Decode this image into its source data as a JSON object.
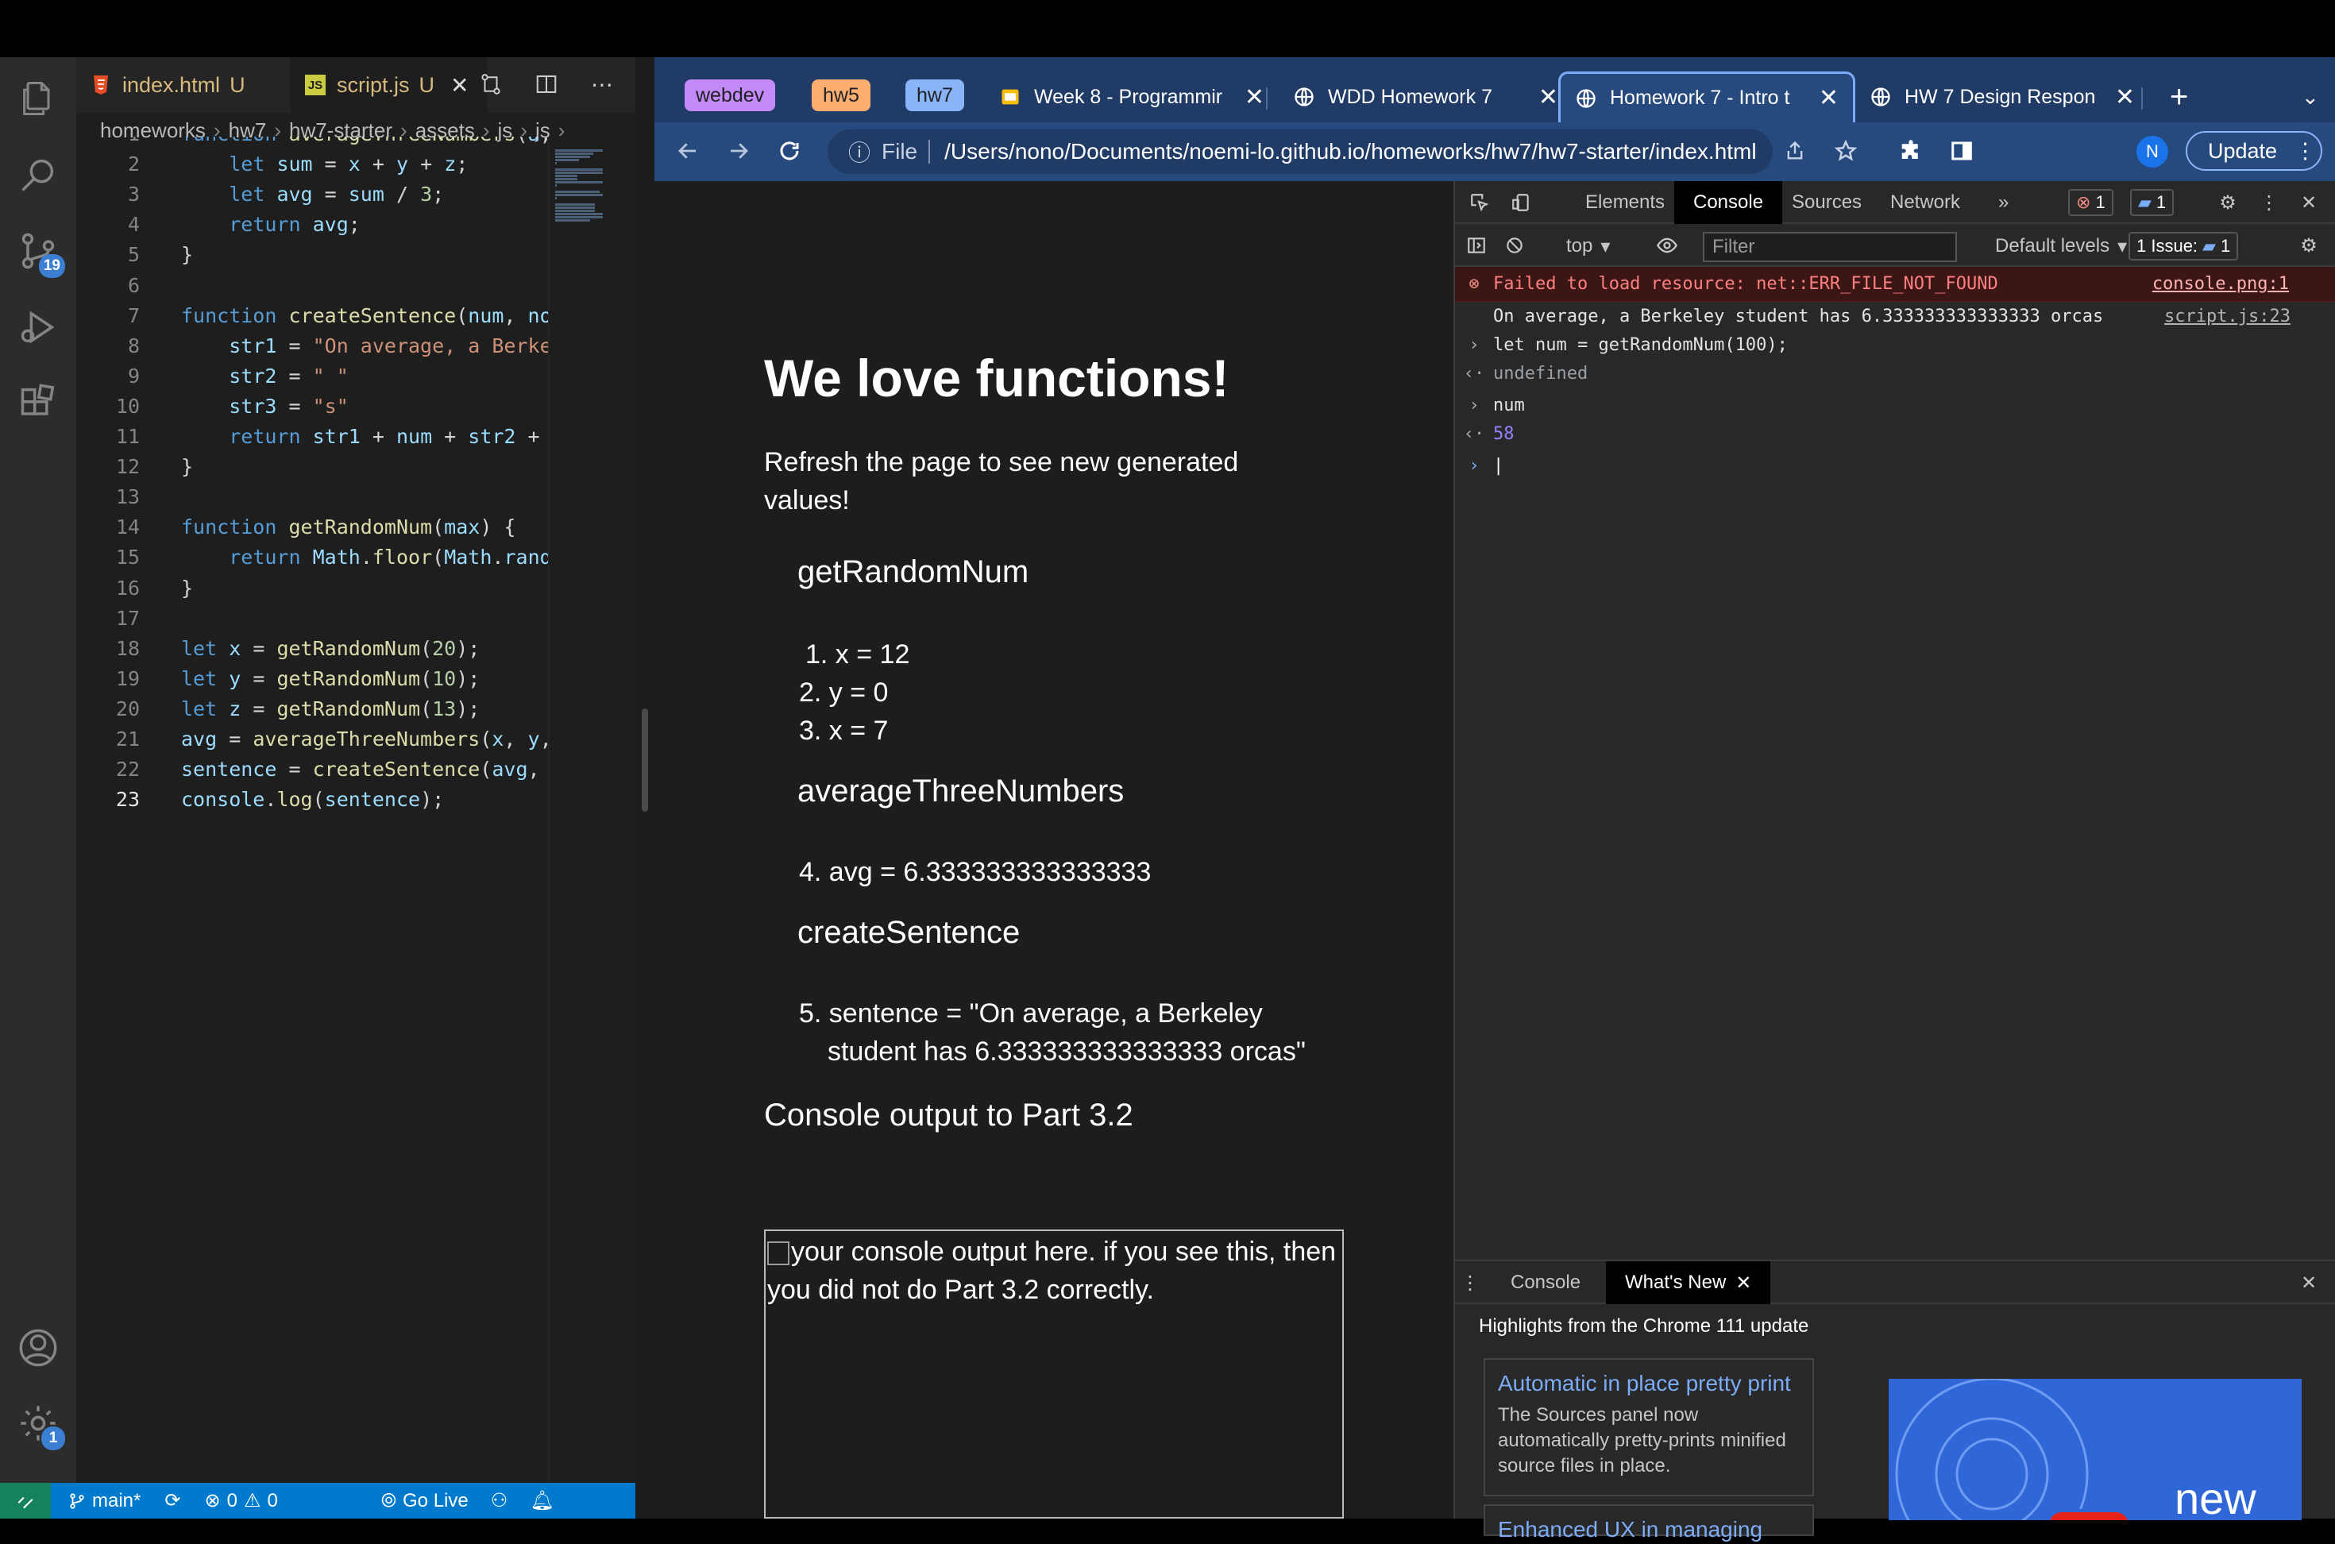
{
  "vscode": {
    "tabs": [
      {
        "label": "index.html",
        "status": "U",
        "icon": "html-icon"
      },
      {
        "label": "script.js",
        "status": "U",
        "icon": "js-icon"
      }
    ],
    "breadcrumb": [
      "homeworks",
      "hw7",
      "hw7-starter",
      "assets",
      "js",
      "js"
    ],
    "scm_badge": "19",
    "settings_badge": "1",
    "code": {
      "lines": [
        {
          "n": "1",
          "text": "function averageThreeNumbers(a,"
        },
        {
          "n": "2",
          "text": "    let sum = x + y + z;"
        },
        {
          "n": "3",
          "text": "    let avg = sum / 3;"
        },
        {
          "n": "4",
          "text": "    return avg;"
        },
        {
          "n": "5",
          "text": "}"
        },
        {
          "n": "6",
          "text": ""
        },
        {
          "n": "7",
          "text": "function createSentence(num, nou"
        },
        {
          "n": "8",
          "text": "    str1 = \"On average, a Berkel"
        },
        {
          "n": "9",
          "text": "    str2 = \" \""
        },
        {
          "n": "10",
          "text": "    str3 = \"s\""
        },
        {
          "n": "11",
          "text": "    return str1 + num + str2 + n"
        },
        {
          "n": "12",
          "text": "}"
        },
        {
          "n": "13",
          "text": ""
        },
        {
          "n": "14",
          "text": "function getRandomNum(max) {"
        },
        {
          "n": "15",
          "text": "    return Math.floor(Math.rando"
        },
        {
          "n": "16",
          "text": "}"
        },
        {
          "n": "17",
          "text": ""
        },
        {
          "n": "18",
          "text": "let x = getRandomNum(20);"
        },
        {
          "n": "19",
          "text": "let y = getRandomNum(10);"
        },
        {
          "n": "20",
          "text": "let z = getRandomNum(13);"
        },
        {
          "n": "21",
          "text": "avg = averageThreeNumbers(x, y,"
        },
        {
          "n": "22",
          "text": "sentence = createSentence(avg, \""
        },
        {
          "n": "23",
          "text": "console.log(sentence);"
        }
      ]
    },
    "status": {
      "branch": "main*",
      "errors": "0",
      "warnings": "0",
      "golive": "Go Live"
    }
  },
  "chrome": {
    "groups": [
      {
        "label": "webdev",
        "color": "#c58af9"
      },
      {
        "label": "hw5",
        "color": "#fcad70"
      },
      {
        "label": "hw7",
        "color": "#8ab4f8"
      }
    ],
    "tabs": [
      {
        "title": "Week 8 - Programmir",
        "icon": "slides-icon"
      },
      {
        "title": "WDD Homework 7",
        "icon": "globe-icon"
      },
      {
        "title": "Homework 7 - Intro t",
        "icon": "globe-icon",
        "active": true
      },
      {
        "title": "HW 7 Design Respon",
        "icon": "globe-icon"
      }
    ],
    "new_tab": "+",
    "url_scheme": "File",
    "url": "/Users/nono/Documents/noemi-lo.github.io/homeworks/hw7/hw7-starter/index.html",
    "avatar": "N",
    "update_label": "Update"
  },
  "page": {
    "title": "We love functions!",
    "intro": "Refresh the page to see new generated values!",
    "sections": [
      {
        "heading": "getRandomNum",
        "items": [
          "1. x = 12",
          "2. y = 0",
          "3. x = 7"
        ]
      },
      {
        "heading": "averageThreeNumbers",
        "items": [
          "4. avg = 6.333333333333333"
        ]
      },
      {
        "heading": "createSentence",
        "items": [
          "5. sentence = \"On average, a Berkeley student has 6.333333333333333 orcas\""
        ]
      }
    ],
    "console_heading": "Console output to Part 3.2",
    "img_alt": "your console output here. if you see this, then you did not do Part 3.2 correctly."
  },
  "devtools": {
    "tabs": [
      "Elements",
      "Console",
      "Sources",
      "Network"
    ],
    "error_count": "1",
    "message_count": "1",
    "context": "top",
    "filter_placeholder": "Filter",
    "levels": "Default levels",
    "issues": "1 Issue:",
    "issues_count": "1",
    "console": [
      {
        "type": "error",
        "text": "Failed to load resource: net::ERR_FILE_NOT_FOUND",
        "source": "console.png:1"
      },
      {
        "type": "log",
        "text": "On average, a Berkeley student has 6.333333333333333 orcas",
        "source": "script.js:23"
      },
      {
        "type": "input",
        "text": "let num = getRandomNum(100);"
      },
      {
        "type": "result",
        "text": "undefined"
      },
      {
        "type": "input",
        "text": "num"
      },
      {
        "type": "result",
        "text": "58"
      }
    ],
    "drawer": {
      "tabs": [
        "Console",
        "What's New"
      ],
      "title": "Highlights from the Chrome 111 update",
      "cards": [
        {
          "link": "Automatic in place pretty print",
          "desc": "The Sources panel now automatically pretty-prints minified source files in place."
        },
        {
          "link": "Enhanced UX in managing",
          "desc": ""
        }
      ],
      "video_text": "new"
    }
  }
}
